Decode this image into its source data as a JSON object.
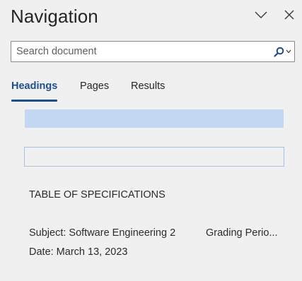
{
  "pane": {
    "title": "Navigation"
  },
  "search": {
    "placeholder": "Search document"
  },
  "tabs": [
    {
      "label": "Headings",
      "active": true
    },
    {
      "label": "Pages",
      "active": false
    },
    {
      "label": "Results",
      "active": false
    }
  ],
  "headings": {
    "toc": "TABLE OF SPECIFICATIONS",
    "subject": "Subject: Software Engineering 2",
    "grading": "Grading Perio...",
    "date": "Date: March 13, 2023"
  },
  "icons": {
    "collapse": "chevron-down-icon",
    "close": "close-icon",
    "search": "search-icon",
    "dropdown": "caret-down-icon"
  },
  "colors": {
    "accent": "#1f4e8c",
    "selected_heading": "#c3d7f2",
    "heading_outline": "#a8bfe3",
    "background": "#f0f0f0"
  }
}
